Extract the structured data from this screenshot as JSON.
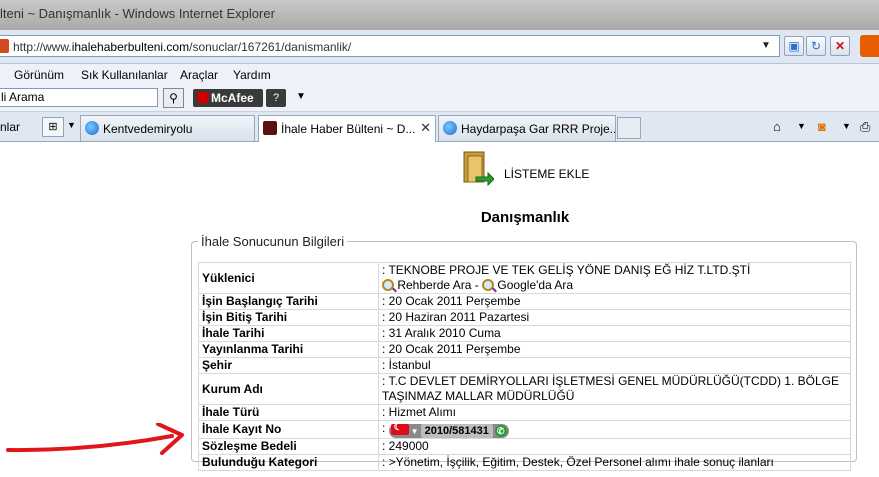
{
  "window": {
    "title": "lteni ~ Danışmanlık - Windows Internet Explorer"
  },
  "address": {
    "url_prefix": "http://www.",
    "url_domain": "ihalehaberbulteni.com",
    "url_path": "/sonuclar/167261/danismanlik/"
  },
  "menu": {
    "items": [
      "Görünüm",
      "Sık Kullanılanlar",
      "Araçlar",
      "Yardım"
    ]
  },
  "toolbar": {
    "search_value": "li Arama",
    "mcafee_label": "McAfee",
    "help_label": "?"
  },
  "tabs": {
    "left_label": "nlar",
    "items": [
      {
        "label": "Kentvedemiryolu"
      },
      {
        "label": "İhale Haber Bülteni ~ D..."
      },
      {
        "label": "Haydarpaşa Gar RRR Proje..."
      }
    ]
  },
  "page": {
    "liste_ekle": "LİSTEME EKLE",
    "title": "Danışmanlık",
    "legend": "İhale Sonucunun Bilgileri",
    "rows": [
      {
        "key": "Yüklenici",
        "value": ": TEKNOBE PROJE VE TEK GELİŞ YÖNE DANIŞ EĞ HİZ T.LTD.ŞTİ",
        "link1": "Rehberde Ara",
        "sep": " - ",
        "link2": "Google'da Ara"
      },
      {
        "key": "İşin Başlangıç Tarihi",
        "value": ": 20 Ocak 2011 Perşembe"
      },
      {
        "key": "İşin Bitiş Tarihi",
        "value": ": 20 Haziran 2011 Pazartesi"
      },
      {
        "key": "İhale Tarihi",
        "value": ": 31 Aralık 2010 Cuma"
      },
      {
        "key": "Yayınlanma Tarihi",
        "value": ": 20 Ocak 2011 Perşembe"
      },
      {
        "key": "Şehir",
        "value": ": İstanbul"
      },
      {
        "key": "Kurum Adı",
        "value": ": T.C DEVLET DEMİRYOLLARI İŞLETMESİ GENEL MÜDÜRLÜĞÜ(TCDD) 1. BÖLGE TAŞINMAZ MALLAR MÜDÜRLÜĞÜ"
      },
      {
        "key": "İhale Türü",
        "value": ": Hizmet Alımı"
      },
      {
        "key": "İhale Kayıt No",
        "value": ": ",
        "kayit_no": "2010/581431"
      },
      {
        "key": "Sözleşme Bedeli",
        "value": ": 249000"
      },
      {
        "key": "Bulunduğu Kategori",
        "value": ": >Yönetim, İşçilik, Eğitim, Destek, Özel Personel alımı ihale sonuç ilanları"
      }
    ]
  },
  "colors": {
    "annotation_arrow": "#e0161a",
    "window_frame": "#dfe7f2"
  }
}
